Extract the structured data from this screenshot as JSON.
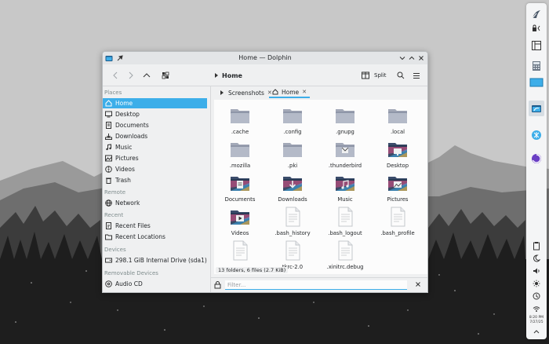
{
  "window": {
    "title": "Home — Dolphin"
  },
  "toolbar": {
    "breadcrumb": "Home",
    "split_label": "Split"
  },
  "tabs": [
    {
      "label": "Screenshots",
      "active": false
    },
    {
      "label": "Home",
      "active": true
    }
  ],
  "sidebar": {
    "sections": {
      "places": "Places",
      "remote": "Remote",
      "recent": "Recent",
      "devices": "Devices",
      "removable": "Removable Devices"
    },
    "places": [
      {
        "label": "Home",
        "icon": "home-icon",
        "active": true
      },
      {
        "label": "Desktop",
        "icon": "desktop-icon"
      },
      {
        "label": "Documents",
        "icon": "documents-icon"
      },
      {
        "label": "Downloads",
        "icon": "downloads-icon"
      },
      {
        "label": "Music",
        "icon": "music-icon"
      },
      {
        "label": "Pictures",
        "icon": "pictures-icon"
      },
      {
        "label": "Videos",
        "icon": "videos-icon"
      },
      {
        "label": "Trash",
        "icon": "trash-icon"
      }
    ],
    "remote": [
      {
        "label": "Network",
        "icon": "network-icon"
      }
    ],
    "recent": [
      {
        "label": "Recent Files",
        "icon": "recent-files-icon"
      },
      {
        "label": "Recent Locations",
        "icon": "recent-locations-icon"
      }
    ],
    "devices": [
      {
        "label": "298.1 GiB Internal Drive (sda1)",
        "icon": "drive-icon"
      }
    ],
    "removable": [
      {
        "label": "Audio CD",
        "icon": "cd-icon"
      }
    ]
  },
  "files": [
    {
      "name": ".cache",
      "type": "folder"
    },
    {
      "name": ".config",
      "type": "folder"
    },
    {
      "name": ".gnupg",
      "type": "folder"
    },
    {
      "name": ".local",
      "type": "folder"
    },
    {
      "name": ".mozilla",
      "type": "folder"
    },
    {
      "name": ".pki",
      "type": "folder"
    },
    {
      "name": ".thunderbird",
      "type": "folder-thunderbird"
    },
    {
      "name": "Desktop",
      "type": "folder-desktop"
    },
    {
      "name": "Documents",
      "type": "folder-documents"
    },
    {
      "name": "Downloads",
      "type": "folder-downloads"
    },
    {
      "name": "Music",
      "type": "folder-music"
    },
    {
      "name": "Pictures",
      "type": "folder-pictures"
    },
    {
      "name": "Videos",
      "type": "folder-videos"
    },
    {
      "name": ".bash_history",
      "type": "file"
    },
    {
      "name": ".bash_logout",
      "type": "file"
    },
    {
      "name": ".bash_profile",
      "type": "file"
    },
    {
      "name": "",
      "type": "file"
    },
    {
      "name": "tkrc-2.0",
      "type": "file"
    },
    {
      "name": ".xinitrc.debug",
      "type": "file"
    }
  ],
  "status": {
    "text": "13 folders, 6 files (2.7 KiB)"
  },
  "filter": {
    "placeholder": "Filter..."
  },
  "panel": {
    "clock_time": "8:20 PM",
    "clock_date": "7/27/25"
  },
  "colors": {
    "accent": "#3daee9",
    "folder": "#8f96a8"
  }
}
